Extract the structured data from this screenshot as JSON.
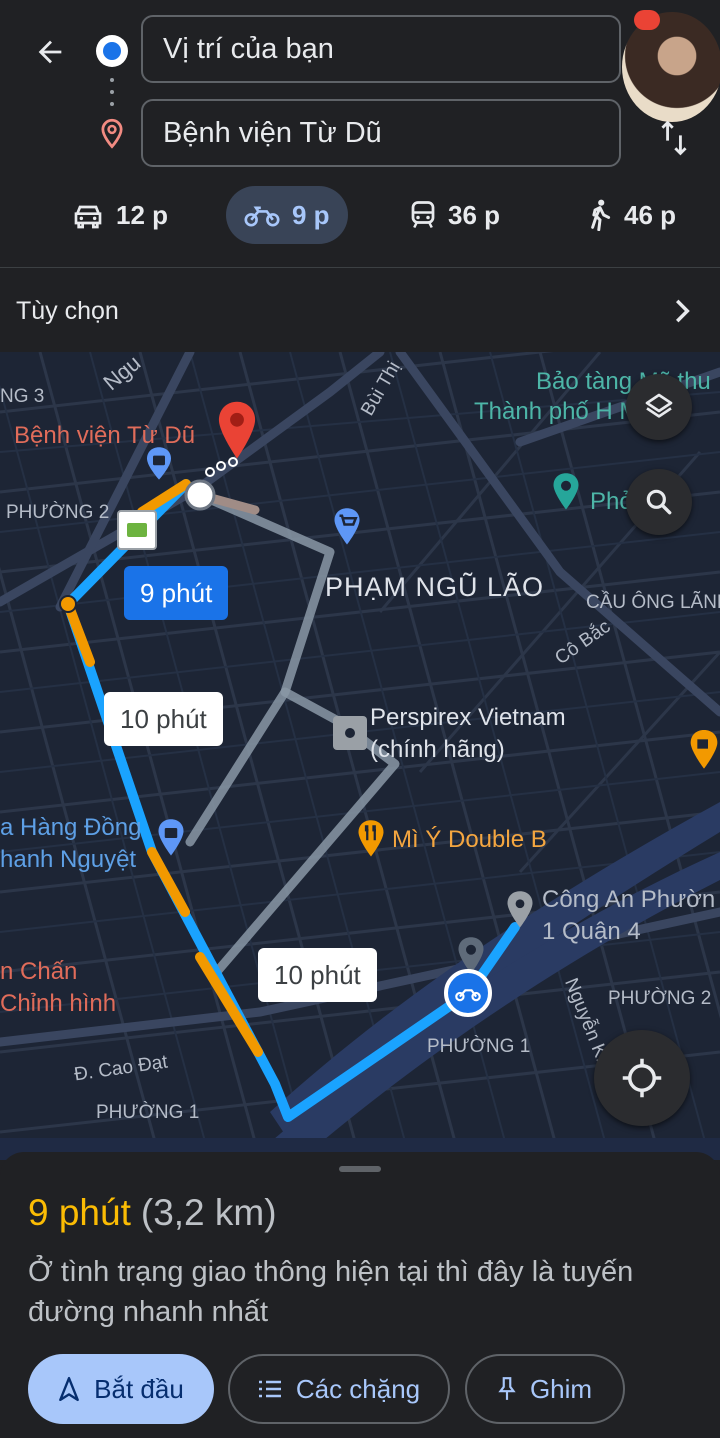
{
  "search": {
    "origin_value": "Vị trí của bạn",
    "destination_value": "Bệnh viện Từ Dũ"
  },
  "modes": [
    {
      "name": "car",
      "icon": "car-icon",
      "time": "12 p",
      "active": false
    },
    {
      "name": "motorbike",
      "icon": "motorbike-icon",
      "time": "9 p",
      "active": true
    },
    {
      "name": "transit",
      "icon": "transit-icon",
      "time": "36 p",
      "active": false
    },
    {
      "name": "walk",
      "icon": "walk-icon",
      "time": "46 p",
      "active": false
    }
  ],
  "options": {
    "label": "Tùy chọn"
  },
  "map": {
    "places": {
      "destination": "Bệnh viện Từ Dũ",
      "museum_line1": "Bảo tàng Mỹ thu",
      "museum_line2": "Thành phố H  Mi",
      "pho": "Phở",
      "perspirex_line1": "Perspirex Vietnam",
      "perspirex_line2": "(chính hãng)",
      "restaurant": "Mì Ý Double B",
      "police_line1": "Công An Phườn",
      "police_line2": "1 Quận 4",
      "shop_line1": "a Hàng Đồng",
      "shop_line2": "hanh Nguyệt",
      "clinic_line1": "n Chấn",
      "clinic_line2": "Chỉnh hình"
    },
    "areas": {
      "pham_ngu_lao": "PHẠM NGŨ LÃO",
      "cau_ong_lanh": "CẦU ÔNG LÃNH",
      "phuong_2_left": "PHƯỜNG 2",
      "phuong_2_right": "PHƯỜNG 2",
      "phuong_1_center": "PHƯỜNG 1",
      "phuong_1_bottom": "PHƯỜNG 1",
      "ng_3": "NG 3"
    },
    "streets": {
      "cao_dat": "Đ. Cao Đạt",
      "co_bac": "Cô Bắc",
      "bui_thi": "Bùi Thị",
      "nguyen": "Nguyễn Kh",
      "ngu": "Ngu"
    },
    "route_bubbles": {
      "primary": "9 phút",
      "alt1": "10 phút",
      "alt2": "10 phút"
    },
    "colors": {
      "primary_route": "#1aa3ff",
      "traffic_slow": "#f29900",
      "alt_route": "#8a98a6",
      "destination_pin": "#ea4335"
    }
  },
  "summary": {
    "time": "9 phút",
    "distance": "(3,2 km)",
    "note": "Ở tình trạng giao thông hiện tại thì đây là tuyến đường nhanh nhất"
  },
  "actions": {
    "start": "Bắt đầu",
    "steps": "Các chặng",
    "pin": "Ghim"
  }
}
